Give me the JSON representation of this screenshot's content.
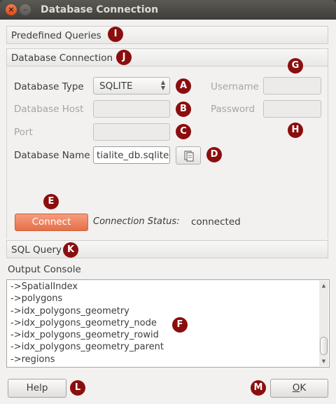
{
  "window": {
    "title": "Database Connection"
  },
  "sections": {
    "predefined": "Predefined Queries",
    "connection": "Database Connection",
    "sql": "SQL Query"
  },
  "form": {
    "db_type_label": "Database Type",
    "db_type_value": "SQLITE",
    "db_host_label": "Database Host",
    "port_label": "Port",
    "db_name_label": "Database Name",
    "db_name_value": "tialite_db.sqlite",
    "username_label": "Username",
    "password_label": "Password"
  },
  "connect": {
    "button": "Connect",
    "status_label": "Connection Status:",
    "status_value": "connected"
  },
  "console": {
    "label": "Output Console",
    "lines": [
      "->SpatialIndex",
      "->polygons",
      "->idx_polygons_geometry",
      "->idx_polygons_geometry_node",
      "->idx_polygons_geometry_rowid",
      "->idx_polygons_geometry_parent",
      "->regions"
    ]
  },
  "buttons": {
    "help": "Help",
    "ok_prefix": "",
    "ok_underlined": "O",
    "ok_rest": "K"
  },
  "badges": {
    "A": "A",
    "B": "B",
    "C": "C",
    "D": "D",
    "E": "E",
    "F": "F",
    "G": "G",
    "H": "H",
    "I": "I",
    "J": "J",
    "K": "K",
    "L": "L",
    "M": "M"
  },
  "colors": {
    "accent": "#e66f47",
    "badge": "#8b0e0e",
    "titlebar": "#3f3e3a"
  }
}
